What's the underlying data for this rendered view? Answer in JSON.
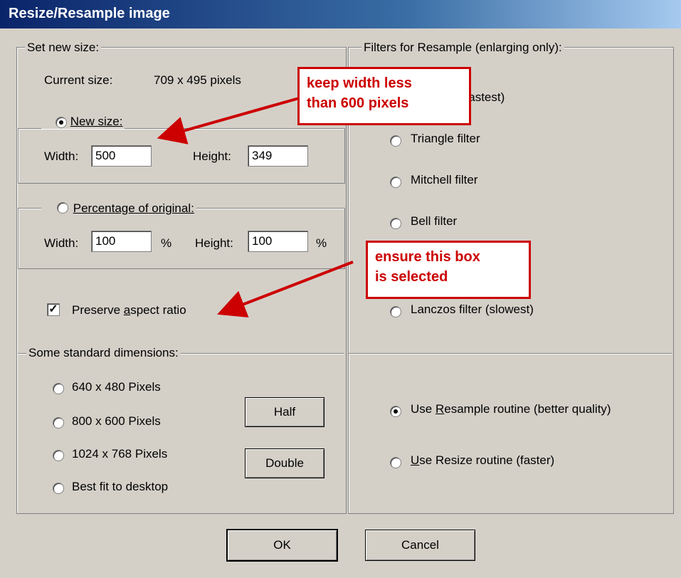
{
  "window": {
    "title": "Resize/Resample image"
  },
  "left": {
    "set_new_size_legend": "Set new size:",
    "current_size_label": "Current size:",
    "current_size_value": "709  x  495  pixels",
    "new_size_label": "New size:",
    "width_label": "Width:",
    "height_label": "Height:",
    "new_width": "500",
    "new_height": "349",
    "percentage_label": "Percentage of original:",
    "pct_width_label": "Width:",
    "pct_height_label": "Height:",
    "pct_width": "100",
    "pct_height": "100",
    "percent_sign": "%",
    "preserve_label": "Preserve aspect ratio",
    "preserve_checked": true,
    "standard_legend": "Some standard dimensions:",
    "std_640": "640 x 480 Pixels",
    "std_800": "800 x 600 Pixels",
    "std_1024": "1024 x 768 Pixels",
    "std_best": "Best fit to desktop",
    "half_button": "Half",
    "double_button": "Double"
  },
  "right": {
    "filters_legend": "Filters for Resample (enlarging only):",
    "box_filter": "Box filter (fastest)",
    "triangle_filter": "Triangle filter",
    "mitchell_filter": "Mitchell filter",
    "bell_filter": "Bell filter",
    "lanczos_filter": "Lanczos filter (slowest)",
    "use_resample": "Use Resample routine (better quality)",
    "use_resize": "Use Resize routine (faster)"
  },
  "buttons": {
    "ok": "OK",
    "cancel": "Cancel"
  },
  "annotations": {
    "callout_width": "keep width less than 600 pixels",
    "callout_width_line1": "keep width less",
    "callout_width_line2": "than 600 pixels",
    "callout_box_line1": "ensure this box",
    "callout_box_line2": "is selected"
  },
  "colors": {
    "dialog_bg": "#d4d0c8",
    "titlebar": "#0a246a",
    "annotation": "#cc0000"
  }
}
